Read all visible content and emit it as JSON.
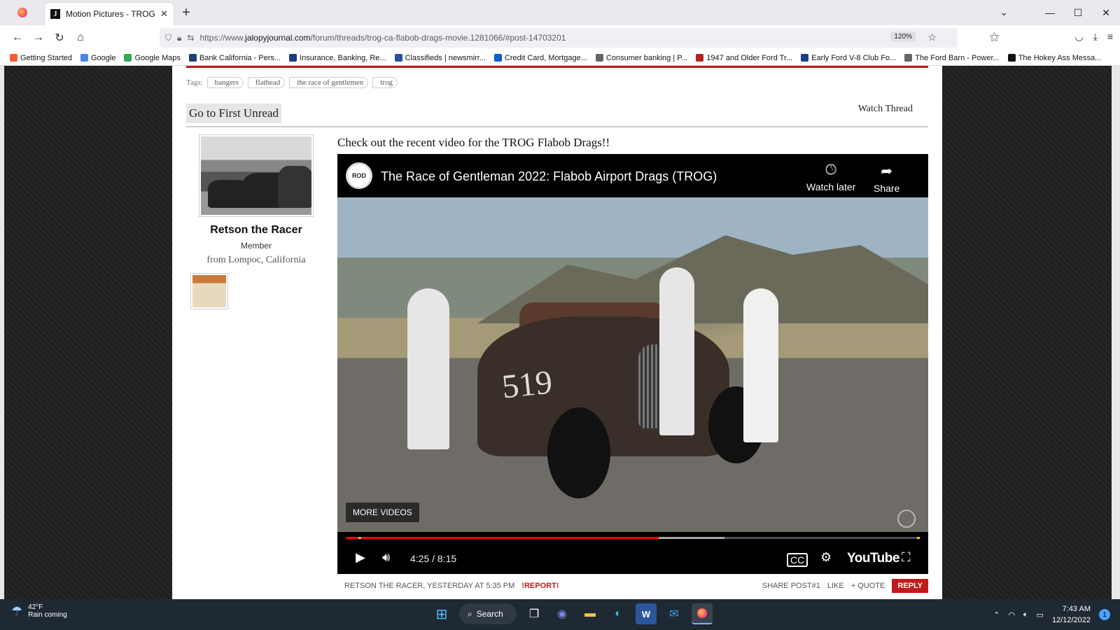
{
  "browser": {
    "tab_title": "Motion Pictures - TROG CA - Fl",
    "url_prefix": "https://www.",
    "url_host": "jalopyjournal.com",
    "url_path": "/forum/threads/trog-ca-flabob-drags-movie.1281066/#post-14703201",
    "zoom": "120%"
  },
  "bookmarks": [
    {
      "label": "Getting Started",
      "color": "#ff5a36"
    },
    {
      "label": "Google",
      "color": "#4285f4"
    },
    {
      "label": "Google Maps",
      "color": "#34a853"
    },
    {
      "label": "Bank California - Pers...",
      "color": "#1d3f72"
    },
    {
      "label": "Insurance, Banking, Re...",
      "color": "#1a3d7c"
    },
    {
      "label": "Classifieds | newsmirr...",
      "color": "#2a4fa0"
    },
    {
      "label": "Credit Card, Mortgage...",
      "color": "#0a5fd6"
    },
    {
      "label": "Consumer banking | P...",
      "color": "#666666"
    },
    {
      "label": "1947 and Older Ford Tr...",
      "color": "#b22222"
    },
    {
      "label": "Early Ford V-8 Club Fo...",
      "color": "#1c3c8c"
    },
    {
      "label": "The Ford Barn - Power...",
      "color": "#666666"
    },
    {
      "label": "The Hokey Ass Messa...",
      "color": "#111111"
    }
  ],
  "thread": {
    "tags_label": "Tags:",
    "tags": [
      "bangers",
      "flathead",
      "the race of gentlemen",
      "trog"
    ],
    "first_unread": "Go to First Unread",
    "watch_thread": "Watch Thread"
  },
  "user": {
    "name": "Retson the Racer",
    "title": "Member",
    "location": "from Lompoc, California"
  },
  "post": {
    "text": "Check out the recent video for the TROG Flabob Drags!!",
    "author_line": "Retson the Racer, Yesterday at 5:35 PM",
    "report": "!Report!",
    "share": "Share Post#1",
    "like": "Like",
    "quote": "+ Quote",
    "reply": "Reply"
  },
  "video": {
    "title": "The Race of Gentleman 2022: Flabob Airport Drags (TROG)",
    "channel_icon": "ROD",
    "watch_later": "Watch later",
    "share": "Share",
    "more_videos": "MORE VIDEOS",
    "time": "4:25 / 8:15",
    "logo": "YouTube",
    "played_fraction": 0.545,
    "buffered_fraction": 0.66,
    "car_number": "519"
  },
  "taskbar": {
    "temp": "42°F",
    "weather": "Rain coming",
    "search": "Search",
    "time": "7:43 AM",
    "date": "12/12/2022",
    "notifications": "1"
  }
}
